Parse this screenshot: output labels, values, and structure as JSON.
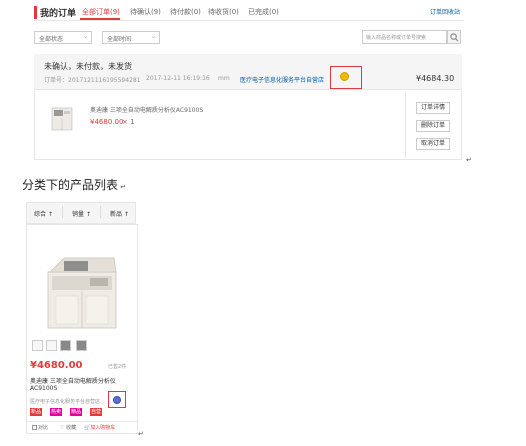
{
  "order_panel": {
    "title": "我的订单",
    "tabs": [
      {
        "label": "全部订单(9)",
        "active": true
      },
      {
        "label": "待确认(9)",
        "active": false
      },
      {
        "label": "待付款(0)",
        "active": false
      },
      {
        "label": "待收货(0)",
        "active": false
      },
      {
        "label": "已完成(0)",
        "active": false
      }
    ],
    "recycle_link": "订单回收站",
    "filter_status": "全部状态",
    "filter_time": "全部时间",
    "search_placeholder": "输入商品名称或订单号搜索",
    "order": {
      "status": "未确认，未付款，未发货",
      "order_no": "订单号：2017121116195594281",
      "datetime": "2017-12-11 16:19:16",
      "user": "mm",
      "store": "医疗电子信息化服务平台自营店",
      "total": "¥4684.30",
      "product_name": "奥迪康 三项全自动电解质分析仪AC9100S",
      "product_price": "¥4680.00",
      "product_qty": "× 1",
      "actions": [
        "订单详情",
        "删除订单",
        "取消订单"
      ]
    }
  },
  "caption": "分类下的产品列表",
  "product_list": {
    "sort": [
      {
        "label": "综合",
        "arrow": "↑"
      },
      {
        "label": "销量",
        "arrow": "↑"
      },
      {
        "label": "新品",
        "arrow": "↑"
      }
    ],
    "price": "¥4680.00",
    "sold": "已售2件",
    "name_line1": "奥迪康 三项全自动电解质分析仪",
    "name_line2": "AC9100S",
    "store": "医疗电子信息化服务平台自营店",
    "tags": [
      "新品",
      "热卖",
      "精品",
      "自营"
    ],
    "compare": "对比",
    "favorite": "收藏",
    "add_cart": "加入购物车"
  },
  "colors": {
    "accent": "#e4393c",
    "link": "#005ea7",
    "store_icon_top": "#f5b700",
    "store_icon_bottom": "#5b6fd6"
  }
}
